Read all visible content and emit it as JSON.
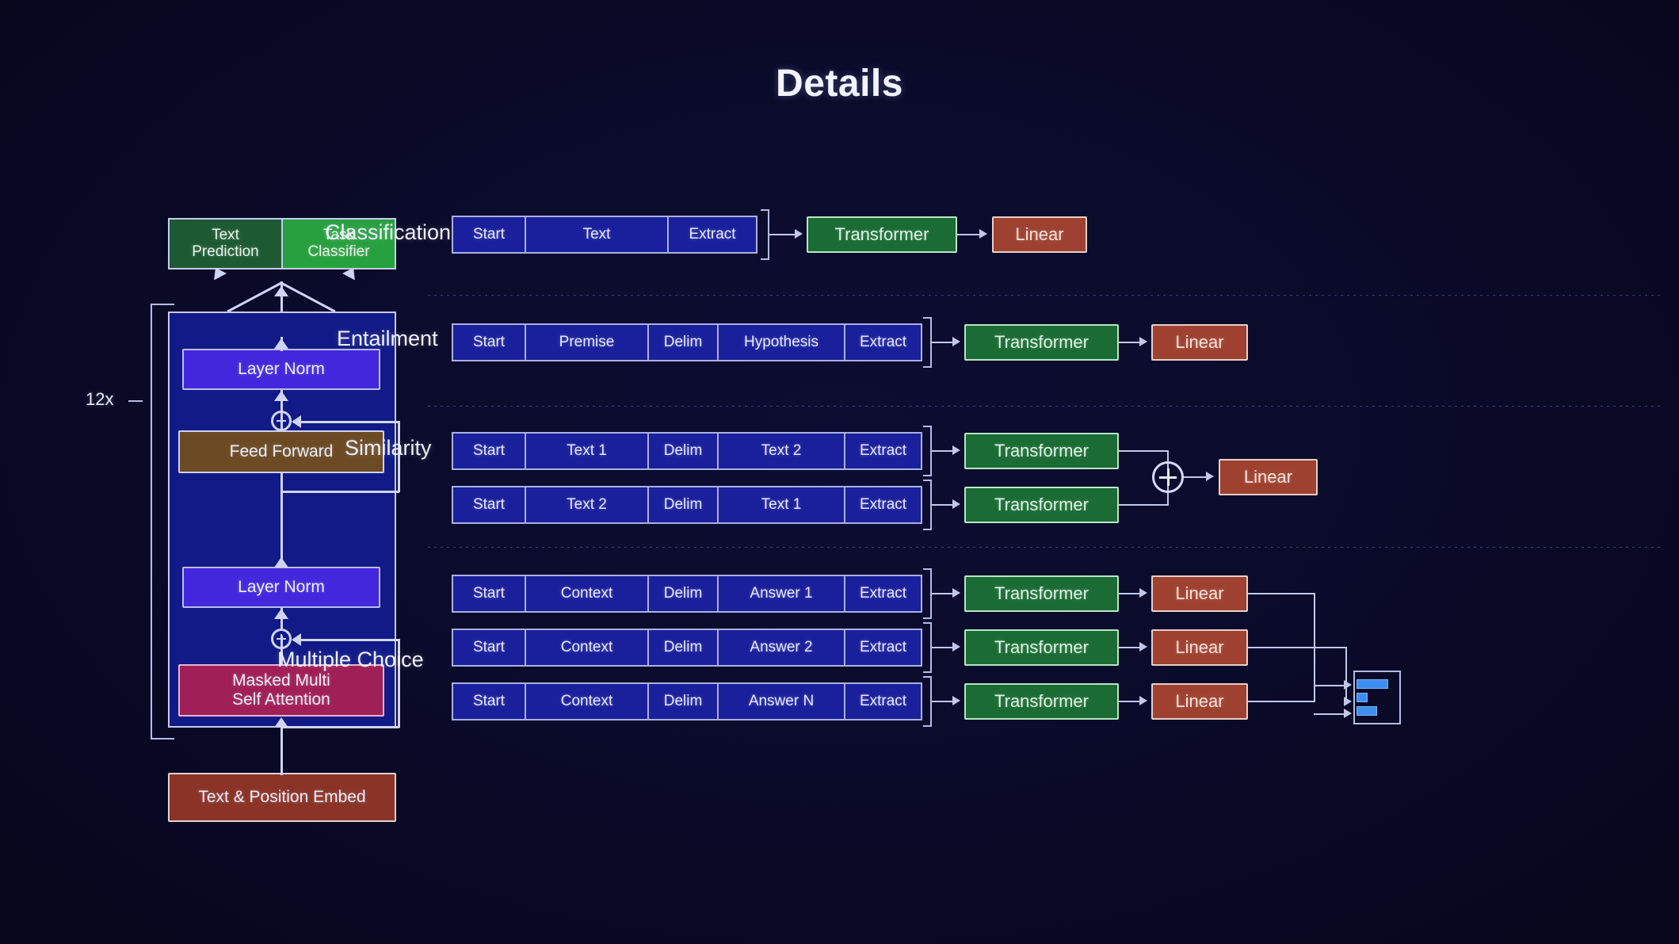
{
  "title": "Details",
  "colors": {
    "background": "#0a0a28",
    "transformer_green": "#1a6b34",
    "linear_red": "#9e4131",
    "token_blue": "#1a1f9c",
    "layer_norm_purple": "#4327dd",
    "feed_forward_brown": "#6b4a24",
    "attention_crimson": "#a01f56",
    "embed_brick": "#8a3326",
    "text_prediction_green": "#1d5a33",
    "task_classifier_green": "#27a03f",
    "softmax_bar_blue": "#3d8ef0",
    "line_white": "#cfd4f2"
  },
  "left_diagram": {
    "heads": [
      {
        "label": "Text\nPrediction",
        "name": "text-prediction"
      },
      {
        "label": "Task\nClassifier",
        "name": "task-classifier"
      }
    ],
    "head_text_prediction": "Text Prediction",
    "head_task_classifier": "Task Classifier",
    "layer_norm_top": "Layer Norm",
    "feed_forward": "Feed Forward",
    "layer_norm_bottom": "Layer Norm",
    "masked_attention": "Masked Multi Self Attention",
    "embedding": "Text & Position Embed",
    "repeat_label": "12x"
  },
  "tasks": [
    {
      "name": "classification",
      "label": "Classification",
      "rows": [
        {
          "tokens": [
            "Start",
            "Text",
            "Extract"
          ],
          "widths": [
            92,
            180,
            110
          ]
        }
      ],
      "transformer": "Transformer",
      "linear": "Linear"
    },
    {
      "name": "entailment",
      "label": "Entailment",
      "rows": [
        {
          "tokens": [
            "Start",
            "Premise",
            "Delim",
            "Hypothesis",
            "Extract"
          ],
          "widths": [
            92,
            155,
            88,
            160,
            95
          ]
        }
      ],
      "transformer": "Transformer",
      "linear": "Linear"
    },
    {
      "name": "similarity",
      "label": "Similarity",
      "rows": [
        {
          "tokens": [
            "Start",
            "Text 1",
            "Delim",
            "Text 2",
            "Extract"
          ],
          "widths": [
            92,
            155,
            88,
            160,
            95
          ]
        },
        {
          "tokens": [
            "Start",
            "Text 2",
            "Delim",
            "Text 1",
            "Extract"
          ],
          "widths": [
            92,
            155,
            88,
            160,
            95
          ]
        }
      ],
      "transformer": "Transformer",
      "linear": "Linear",
      "combiner": "plus"
    },
    {
      "name": "multiple-choice",
      "label": "Multiple Choice",
      "rows": [
        {
          "tokens": [
            "Start",
            "Context",
            "Delim",
            "Answer 1",
            "Extract"
          ],
          "widths": [
            92,
            155,
            88,
            160,
            95
          ]
        },
        {
          "tokens": [
            "Start",
            "Context",
            "Delim",
            "Answer 2",
            "Extract"
          ],
          "widths": [
            92,
            155,
            88,
            160,
            95
          ]
        },
        {
          "tokens": [
            "Start",
            "Context",
            "Delim",
            "Answer N",
            "Extract"
          ],
          "widths": [
            92,
            155,
            88,
            160,
            95
          ]
        }
      ],
      "transformer": "Transformer",
      "linear": "Linear",
      "output": "softmax-bars"
    }
  ],
  "softmax_bars": [
    40,
    14,
    26
  ]
}
